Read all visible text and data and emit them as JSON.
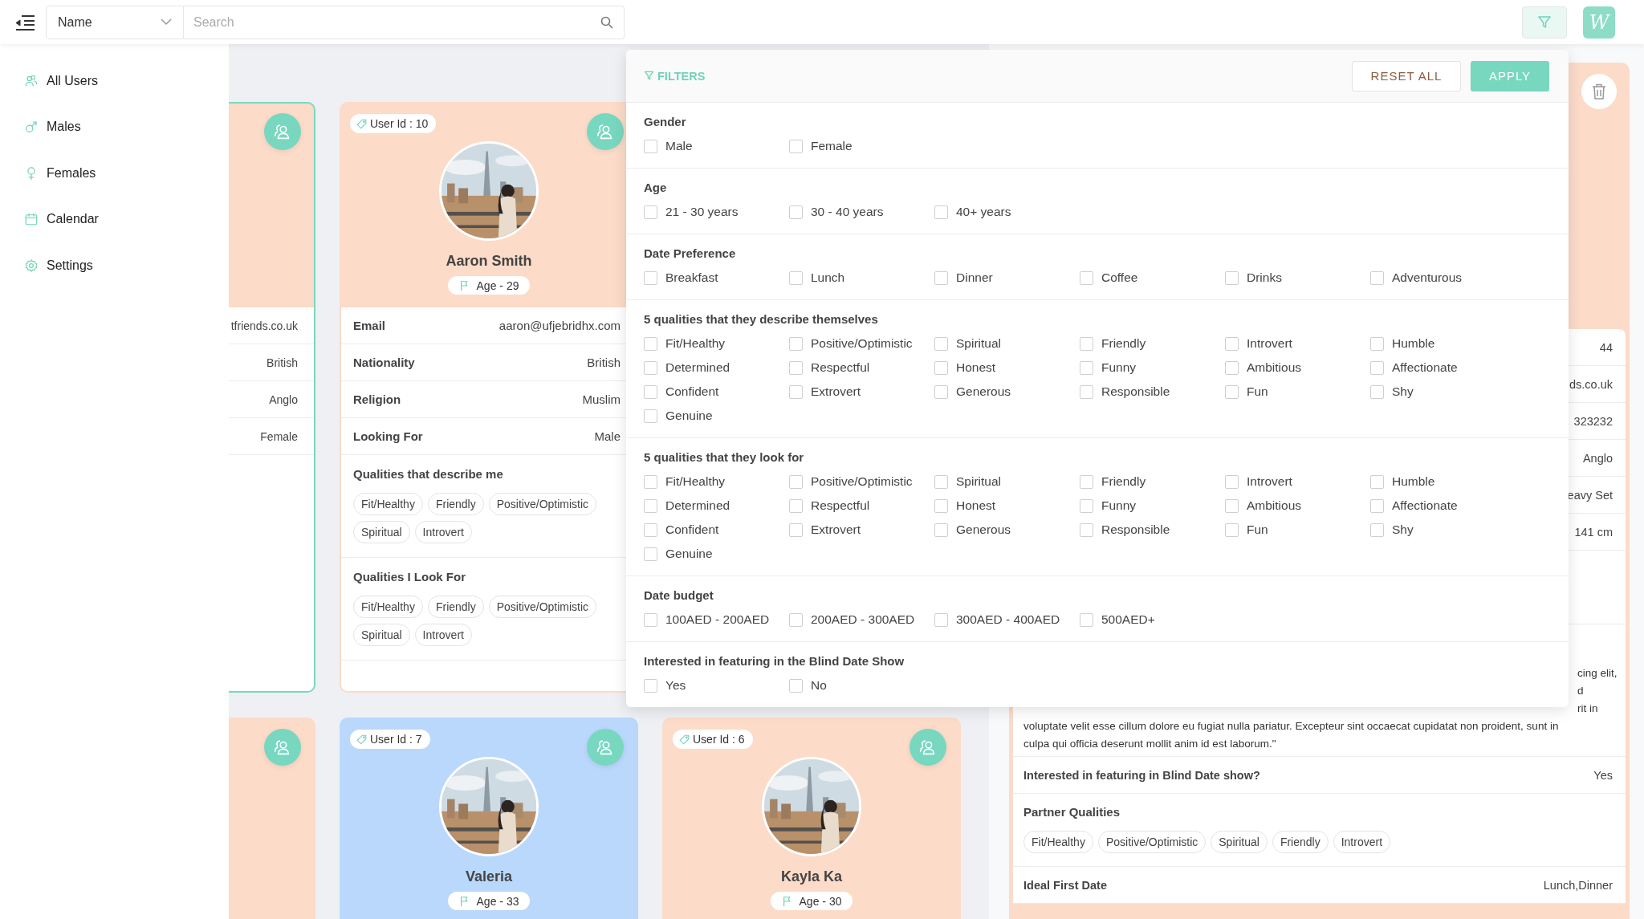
{
  "topbar": {
    "search_by": "Name",
    "search": {
      "placeholder": "Search"
    },
    "filter_active": true,
    "avatar_letter": "W"
  },
  "sidebar": {
    "items": [
      {
        "label": "All Users"
      },
      {
        "label": "Males"
      },
      {
        "label": "Females"
      },
      {
        "label": "Calendar"
      },
      {
        "label": "Settings"
      }
    ]
  },
  "card_rows": [
    [
      {
        "kind": "partial",
        "color": "#fcdbc9",
        "selected": true,
        "rows": [
          {
            "value": "tfriends.co.uk"
          },
          {
            "value": "British"
          },
          {
            "value": "Anglo"
          },
          {
            "value": "Female"
          }
        ]
      },
      {
        "kind": "full",
        "color": "#fcdbc9",
        "selected": false,
        "user_id": "User Id : 10",
        "name": "Aaron Smith",
        "age": "Age - 29",
        "rows": [
          {
            "label": "Email",
            "value": "aaron@ufjebridhx.com"
          },
          {
            "label": "Nationality",
            "value": "British"
          },
          {
            "label": "Religion",
            "value": "Muslim"
          },
          {
            "label": "Looking For",
            "value": "Male"
          }
        ],
        "sections": [
          {
            "title": "Qualities that describe me",
            "chips": [
              "Fit/Healthy",
              "Friendly",
              "Positive/Optimistic",
              "Spiritual",
              "Introvert"
            ]
          },
          {
            "title": "Qualities I Look For",
            "chips": [
              "Fit/Healthy",
              "Friendly",
              "Positive/Optimistic",
              "Spiritual",
              "Introvert"
            ]
          }
        ]
      }
    ],
    [
      {
        "kind": "partial",
        "color": "#fcdbc9",
        "selected": false
      },
      {
        "kind": "full",
        "color": "#b9d8fb",
        "selected": false,
        "user_id": "User Id : 7",
        "name": "Valeria",
        "age": "Age - 33"
      },
      {
        "kind": "full",
        "color": "#fcdbc9",
        "selected": false,
        "user_id": "User Id : 6",
        "name": "Kayla Ka",
        "age": "Age - 30"
      }
    ]
  ],
  "detail": {
    "values": [
      "44",
      "ds.co.uk",
      "323232",
      "Anglo",
      "eavy Set",
      "141 cm"
    ],
    "about_fragments": [
      "cing elit,",
      "d",
      "rit in"
    ],
    "about_lines": [
      "voluptate velit esse cillum dolore eu fugiat nulla pariatur. Excepteur sint occaecat cupidatat non proident, sunt in",
      "culpa qui officia deserunt mollit anim id est laborum.\""
    ],
    "interested": {
      "label": "Interested in featuring in Blind Date show?",
      "value": "Yes"
    },
    "partner": {
      "title": "Partner Qualities",
      "chips": [
        "Fit/Healthy",
        "Positive/Optimistic",
        "Spiritual",
        "Friendly",
        "Introvert"
      ]
    },
    "ideal": {
      "label": "Ideal First Date",
      "value": "Lunch,Dinner"
    }
  },
  "filters": {
    "title": "FILTERS",
    "reset_label": "RESET ALL",
    "apply_label": "APPLY",
    "groups": [
      {
        "title": "Gender",
        "options": [
          {
            "label": "Male",
            "checked": false
          },
          {
            "label": "Female",
            "checked": false
          }
        ]
      },
      {
        "title": "Age",
        "options": [
          {
            "label": "21 - 30 years",
            "checked": false
          },
          {
            "label": "30 - 40 years",
            "checked": false
          },
          {
            "label": "40+ years",
            "checked": false
          }
        ]
      },
      {
        "title": "Date Preference",
        "options": [
          {
            "label": "Breakfast",
            "checked": false
          },
          {
            "label": "Lunch",
            "checked": false
          },
          {
            "label": "Dinner",
            "checked": false
          },
          {
            "label": "Coffee",
            "checked": false
          },
          {
            "label": "Drinks",
            "checked": false
          },
          {
            "label": "Adventurous",
            "checked": false
          }
        ]
      },
      {
        "title": "5 qualities that they describe themselves",
        "options": [
          {
            "label": "Fit/Healthy",
            "checked": false
          },
          {
            "label": "Positive/Optimistic",
            "checked": false
          },
          {
            "label": "Spiritual",
            "checked": false
          },
          {
            "label": "Friendly",
            "checked": false
          },
          {
            "label": "Introvert",
            "checked": false
          },
          {
            "label": "Humble",
            "checked": false
          },
          {
            "label": "Determined",
            "checked": false
          },
          {
            "label": "Respectful",
            "checked": false
          },
          {
            "label": "Honest",
            "checked": false
          },
          {
            "label": "Funny",
            "checked": false
          },
          {
            "label": "Ambitious",
            "checked": false
          },
          {
            "label": "Affectionate",
            "checked": false
          },
          {
            "label": "Confident",
            "checked": false
          },
          {
            "label": "Extrovert",
            "checked": false
          },
          {
            "label": "Generous",
            "checked": false
          },
          {
            "label": "Responsible",
            "checked": false
          },
          {
            "label": "Fun",
            "checked": false
          },
          {
            "label": "Shy",
            "checked": false
          },
          {
            "label": "Genuine",
            "checked": false
          }
        ]
      },
      {
        "title": "5 qualities that they look for",
        "options": [
          {
            "label": "Fit/Healthy",
            "checked": false
          },
          {
            "label": "Positive/Optimistic",
            "checked": false
          },
          {
            "label": "Spiritual",
            "checked": false
          },
          {
            "label": "Friendly",
            "checked": false
          },
          {
            "label": "Introvert",
            "checked": false
          },
          {
            "label": "Humble",
            "checked": false
          },
          {
            "label": "Determined",
            "checked": false
          },
          {
            "label": "Respectful",
            "checked": false
          },
          {
            "label": "Honest",
            "checked": false
          },
          {
            "label": "Funny",
            "checked": false
          },
          {
            "label": "Ambitious",
            "checked": false
          },
          {
            "label": "Affectionate",
            "checked": false
          },
          {
            "label": "Confident",
            "checked": false
          },
          {
            "label": "Extrovert",
            "checked": false
          },
          {
            "label": "Generous",
            "checked": false
          },
          {
            "label": "Responsible",
            "checked": false
          },
          {
            "label": "Fun",
            "checked": false
          },
          {
            "label": "Shy",
            "checked": false
          },
          {
            "label": "Genuine",
            "checked": false
          }
        ]
      },
      {
        "title": "Date budget",
        "options": [
          {
            "label": "100AED - 200AED",
            "checked": false
          },
          {
            "label": "200AED - 300AED",
            "checked": false
          },
          {
            "label": "300AED - 400AED",
            "checked": false
          },
          {
            "label": "500AED+",
            "checked": false
          }
        ]
      },
      {
        "title": "Interested in featuring in the Blind Date Show",
        "options": [
          {
            "label": "Yes",
            "checked": false
          },
          {
            "label": "No",
            "checked": false
          }
        ]
      }
    ]
  }
}
